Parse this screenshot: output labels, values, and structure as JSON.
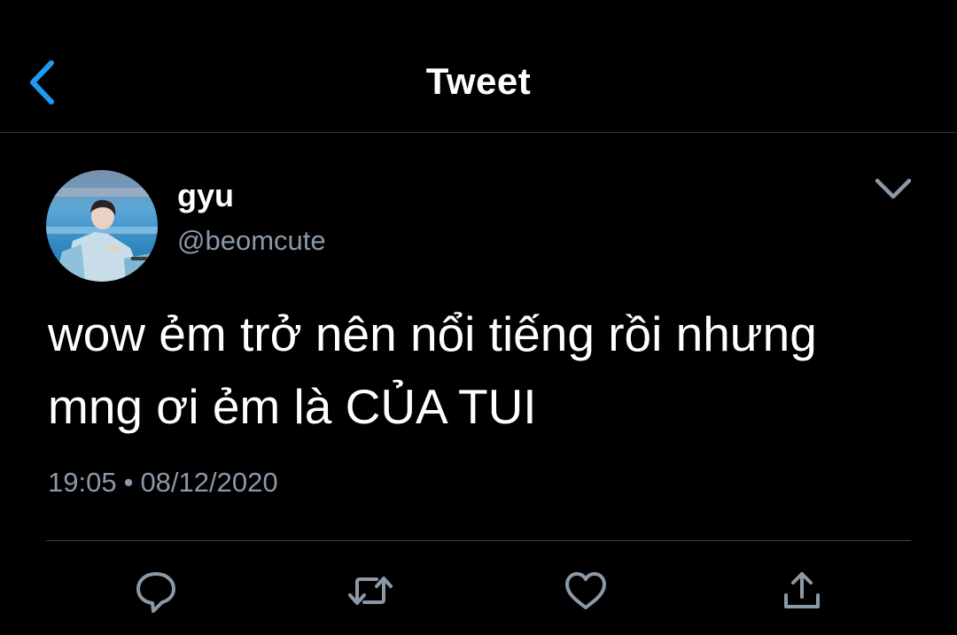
{
  "header": {
    "title": "Tweet",
    "back_icon": "chevron-left-icon"
  },
  "tweet": {
    "user": {
      "display_name": "gyu",
      "handle": "@beomcute",
      "avatar": "avatar-photo"
    },
    "text": "wow ẻm trở nên nổi tiếng rồi nhưng\nmng ơi ẻm là CỦA TUI",
    "time": "19:05",
    "separator": "•",
    "date": "08/12/2020"
  },
  "actions": [
    {
      "icon": "reply-icon"
    },
    {
      "icon": "retweet-icon"
    },
    {
      "icon": "like-icon"
    },
    {
      "icon": "share-icon"
    }
  ],
  "colors": {
    "background": "#000000",
    "accent": "#1d9bf0",
    "secondary_text": "#8b98a5",
    "divider": "#3d4247"
  }
}
